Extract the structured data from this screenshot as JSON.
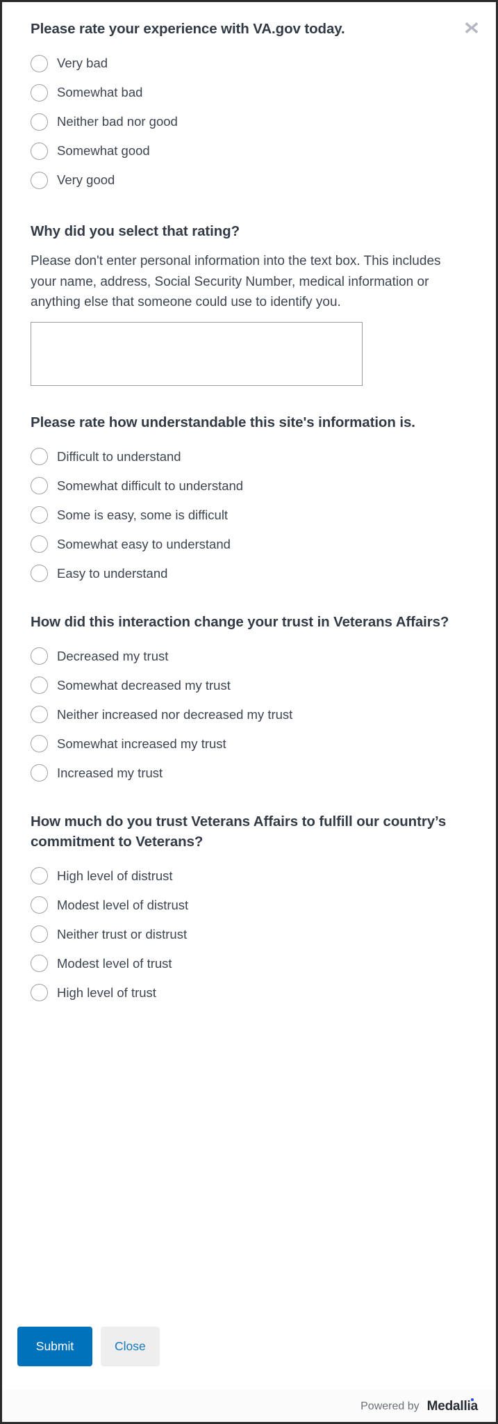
{
  "modal": {
    "close_icon": "close-x-icon"
  },
  "questions": [
    {
      "id": "experience",
      "title": "Please rate your experience with VA.gov today.",
      "options": [
        "Very bad",
        "Somewhat bad",
        "Neither bad nor good",
        "Somewhat good",
        "Very good"
      ]
    },
    {
      "id": "why-rating",
      "title": "Why did you select that rating?",
      "help": "Please don't enter personal information into the text box. This includes your name, address, Social Security Number, medical information or anything else that someone could use to identify you.",
      "textarea_value": "",
      "textarea_placeholder": ""
    },
    {
      "id": "understandable",
      "title": "Please rate how understandable this site's information is.",
      "options": [
        "Difficult to understand",
        "Somewhat difficult to understand",
        "Some is easy, some is difficult",
        "Somewhat easy to understand",
        "Easy to understand"
      ]
    },
    {
      "id": "trust-change",
      "title": "How did this interaction change your trust in Veterans Affairs?",
      "options": [
        "Decreased my trust",
        "Somewhat decreased my trust",
        "Neither increased nor decreased my trust",
        "Somewhat increased my trust",
        "Increased my trust"
      ]
    },
    {
      "id": "trust-level",
      "title": "How much do you trust Veterans Affairs to fulfill our country’s commitment to Veterans?",
      "options": [
        "High level of distrust",
        "Modest level of distrust",
        "Neither trust or distrust",
        "Modest level of trust",
        "High level of trust"
      ]
    }
  ],
  "actions": {
    "submit_label": "Submit",
    "close_label": "Close"
  },
  "footer": {
    "powered_by": "Powered by",
    "brand": "Medallia"
  },
  "colors": {
    "submit_background": "#0071bb",
    "close_background": "#eeeeee",
    "close_text": "#1277bc",
    "heading_text": "#323a45",
    "body_text": "#3d4551",
    "radio_border": "#9aa0a6",
    "brand_dot": "#1b4ae0",
    "close_icon": "#b4b7bd"
  }
}
